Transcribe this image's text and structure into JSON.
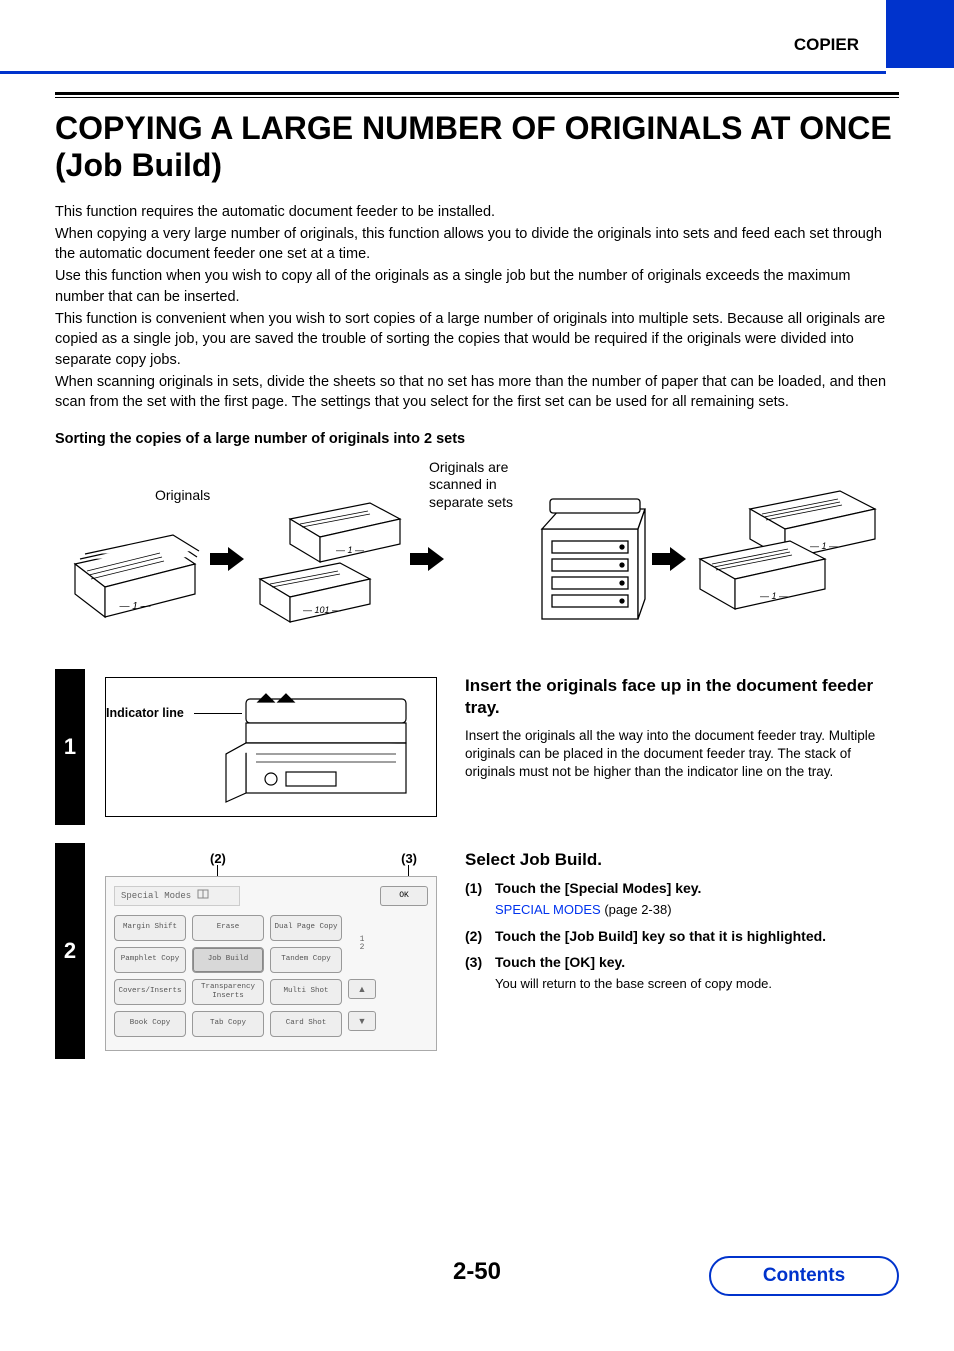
{
  "header": {
    "section": "COPIER"
  },
  "title": "COPYING A LARGE NUMBER OF ORIGINALS AT ONCE (Job Build)",
  "paragraphs": [
    "This function requires the automatic document feeder to be installed.",
    "When copying a very large number of originals, this function allows you to divide the originals into sets and feed each set through the automatic document feeder one set at a time.",
    "Use this function when you wish to copy all of the originals as a single job but the number of originals exceeds the maximum number that can be inserted.",
    "This function is convenient when you wish to sort copies of a large number of originals into multiple sets. Because all originals are copied as a single job, you are saved the trouble of sorting the copies that would be required if the originals were divided into separate copy jobs.",
    "When scanning originals in sets, divide the sheets so that no set has more than the number of paper that can be loaded, and then scan from the set with the first page. The settings that you select for the first set can be used for all remaining sets."
  ],
  "subheading": "Sorting the copies of a large number of originals into 2 sets",
  "diagram": {
    "label_originals": "Originals",
    "label_separate": "Originals are scanned in separate sets",
    "stack1_page": "1",
    "stack2a_page": "1",
    "stack2b_page": "101",
    "out_a": "1",
    "out_b": "1"
  },
  "step1": {
    "number": "1",
    "indicator_label": "Indicator line",
    "heading": "Insert the originals face up in the document feeder tray.",
    "body": "Insert the originals all the way into the document feeder tray. Multiple originals can be placed in the document feeder tray. The stack of originals must not be higher than the indicator line on the tray."
  },
  "step2": {
    "number": "2",
    "callout_2": "(2)",
    "callout_3": "(3)",
    "heading": "Select Job Build.",
    "items": [
      {
        "n": "(1)",
        "t": "Touch the [Special Modes] key."
      },
      {
        "n": "(2)",
        "t": "Touch the [Job Build] key so that it is highlighted."
      },
      {
        "n": "(3)",
        "t": "Touch the [OK] key."
      }
    ],
    "link_text": "SPECIAL MODES",
    "link_ref": " (page 2-38)",
    "note3": "You will return to the base screen of copy mode.",
    "screen": {
      "bar_label": "Special Modes",
      "ok": "OK",
      "pager": "1\n2",
      "buttons": [
        [
          "Margin Shift",
          "Erase",
          "Dual Page Copy"
        ],
        [
          "Pamphlet Copy",
          "Job Build",
          "Tandem Copy"
        ],
        [
          "Covers/Inserts",
          "Transparency Inserts",
          "Multi Shot"
        ],
        [
          "Book Copy",
          "Tab Copy",
          "Card Shot"
        ]
      ],
      "arrows": [
        "▲",
        "▼"
      ]
    }
  },
  "page_number": "2-50",
  "contents_label": "Contents"
}
